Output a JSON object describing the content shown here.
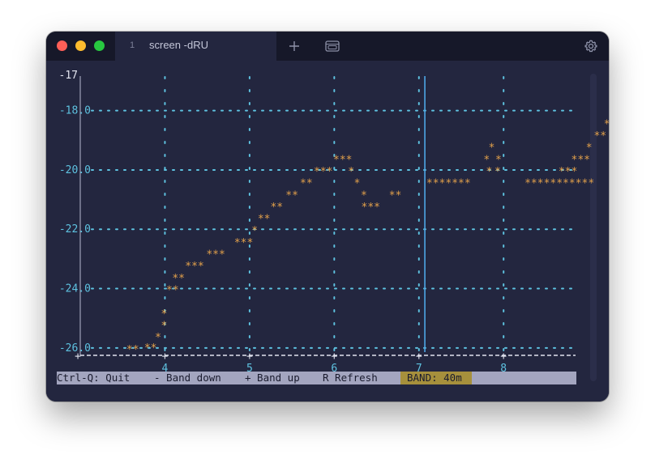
{
  "window": {
    "tab_index": "1",
    "tab_title": "screen -dRU"
  },
  "toolbar": {
    "new_tab_label": "+"
  },
  "colors": {
    "terminal_bg": "#23263f",
    "axis": "#e2e4ef",
    "grid": "#5ec2e0",
    "data_stars": "#e4a24b",
    "cursor": "#4ea7e6",
    "status_bg": "#a3a5bf",
    "band_bg": "#a6903c"
  },
  "chart_data": {
    "type": "scatter",
    "marker": "*",
    "xlim": [
      3.0,
      8.85
    ],
    "ylim": [
      -26.25,
      -17.0
    ],
    "x_ticks": [
      4,
      5,
      6,
      7,
      8
    ],
    "x_tick_labels": [
      "4",
      "5",
      "6",
      "7",
      "8"
    ],
    "y_ticks": [
      -18,
      -20,
      -22,
      -24,
      -26
    ],
    "y_tick_labels": [
      "-18.0",
      "-20.0",
      "-22.0",
      "-24.0",
      "-26.0"
    ],
    "y_top_label": "-17",
    "cursor_x": 7.07,
    "grid": true,
    "points": [
      {
        "x": 3.62,
        "y": -26.0,
        "text": "**"
      },
      {
        "x": 3.83,
        "y": -25.95,
        "text": "**"
      },
      {
        "x": 3.92,
        "y": -25.6,
        "text": "*"
      },
      {
        "x": 3.99,
        "y": -25.2,
        "text": "*"
      },
      {
        "x": 3.99,
        "y": -24.8,
        "text": "*"
      },
      {
        "x": 4.09,
        "y": -24.0,
        "text": "**"
      },
      {
        "x": 4.16,
        "y": -23.6,
        "text": "**"
      },
      {
        "x": 4.35,
        "y": -23.2,
        "text": "***"
      },
      {
        "x": 4.6,
        "y": -22.8,
        "text": "***"
      },
      {
        "x": 4.93,
        "y": -22.4,
        "text": "***"
      },
      {
        "x": 5.06,
        "y": -22.0,
        "text": "*"
      },
      {
        "x": 5.17,
        "y": -21.6,
        "text": "**"
      },
      {
        "x": 5.32,
        "y": -21.2,
        "text": "**"
      },
      {
        "x": 5.5,
        "y": -20.8,
        "text": "**"
      },
      {
        "x": 5.67,
        "y": -20.4,
        "text": "**"
      },
      {
        "x": 5.87,
        "y": -20.0,
        "text": "***"
      },
      {
        "x": 6.1,
        "y": -19.6,
        "text": "***"
      },
      {
        "x": 6.2,
        "y": -20.0,
        "text": "*"
      },
      {
        "x": 6.27,
        "y": -20.4,
        "text": "*"
      },
      {
        "x": 6.35,
        "y": -20.8,
        "text": "*"
      },
      {
        "x": 6.43,
        "y": -21.2,
        "text": "***"
      },
      {
        "x": 6.72,
        "y": -20.8,
        "text": "**"
      },
      {
        "x": 7.35,
        "y": -20.4,
        "text": "*******"
      },
      {
        "x": 7.83,
        "y": -20.0,
        "text": "*"
      },
      {
        "x": 7.8,
        "y": -19.6,
        "text": "*"
      },
      {
        "x": 7.86,
        "y": -19.2,
        "text": "*"
      },
      {
        "x": 7.94,
        "y": -19.6,
        "text": "*"
      },
      {
        "x": 7.93,
        "y": -20.0,
        "text": "*"
      },
      {
        "x": 8.66,
        "y": -20.4,
        "text": "***********"
      },
      {
        "x": 8.76,
        "y": -20.0,
        "text": "***"
      },
      {
        "x": 8.91,
        "y": -19.6,
        "text": "***"
      },
      {
        "x": 9.01,
        "y": -19.2,
        "text": "*"
      },
      {
        "x": 9.14,
        "y": -18.8,
        "text": "**"
      },
      {
        "x": 9.22,
        "y": -18.4,
        "text": "*"
      },
      {
        "x": 9.3,
        "y": -18.0,
        "text": "*"
      },
      {
        "x": 9.51,
        "y": -17.6,
        "text": "****"
      }
    ]
  },
  "status": {
    "quit": "Ctrl-Q: Quit",
    "band_down": "- Band down",
    "band_up": "+ Band up",
    "refresh": "R Refresh",
    "band": "BAND: 40m"
  }
}
